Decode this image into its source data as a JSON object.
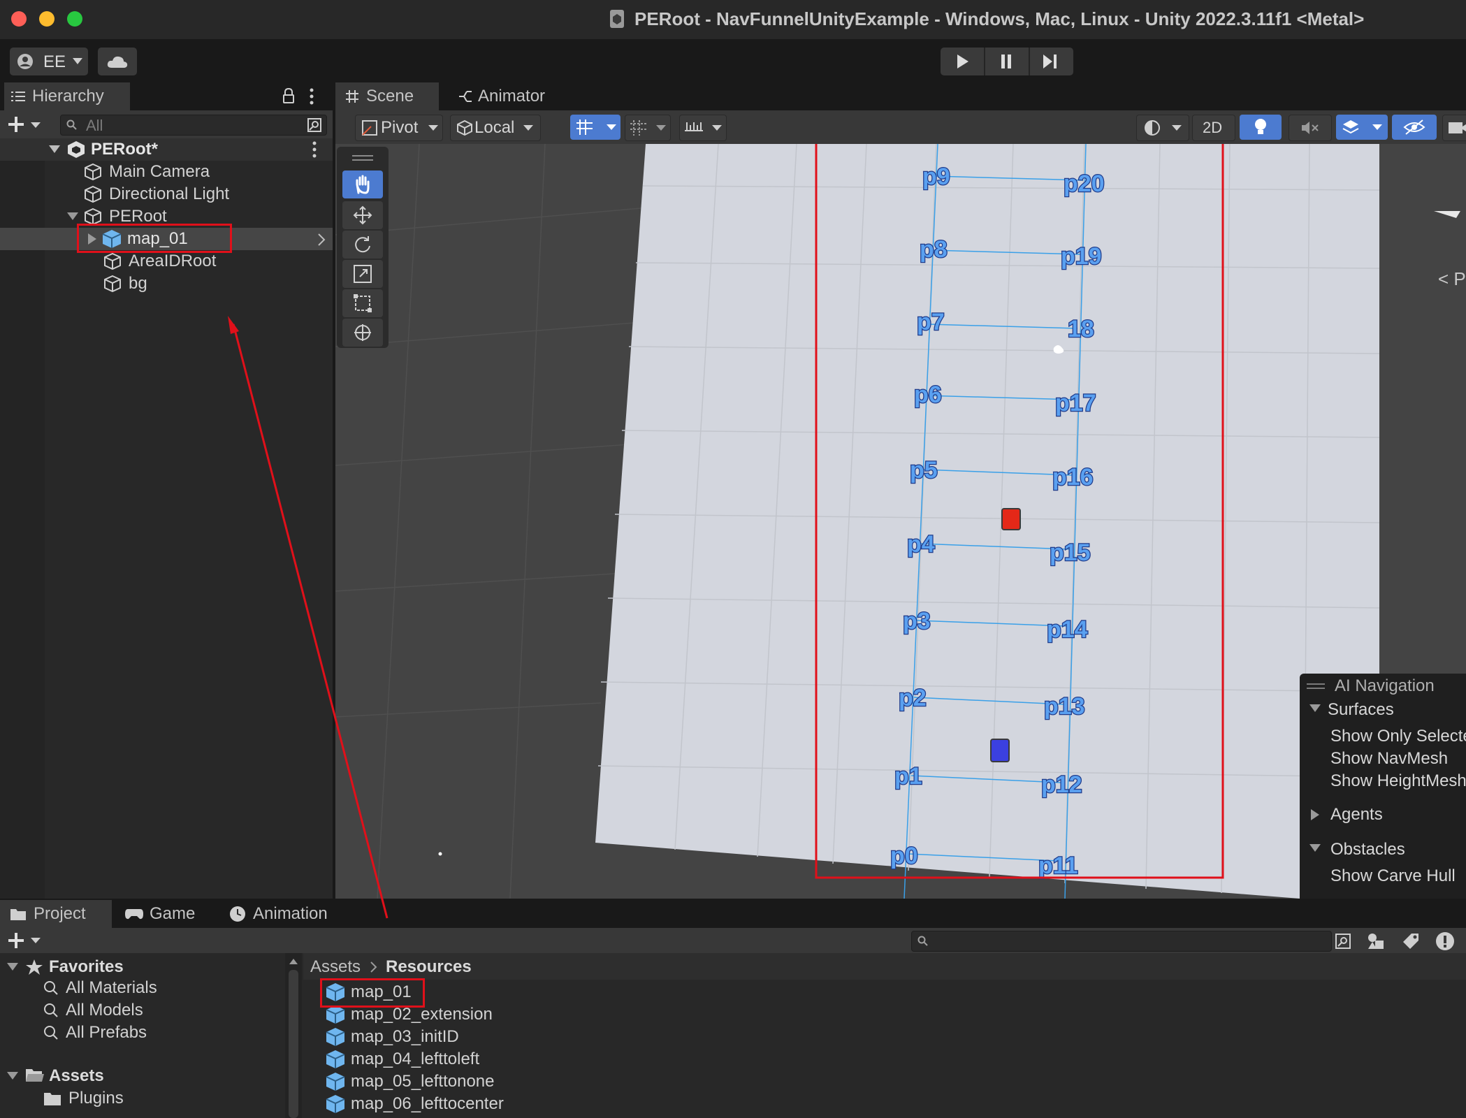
{
  "window": {
    "title": "PERoot - NavFunnelUnityExample - Windows, Mac, Linux - Unity 2022.3.11f1 <Metal>"
  },
  "toolbar": {
    "account_label": "EE",
    "play_icon": "play-icon",
    "pause_icon": "pause-icon",
    "step_icon": "step-icon"
  },
  "hierarchy": {
    "tab_label": "Hierarchy",
    "search_placeholder": "All",
    "scene_root": "PERoot*",
    "items": [
      {
        "label": "Main Camera"
      },
      {
        "label": "Directional Light"
      },
      {
        "label": "PERoot"
      },
      {
        "label": "map_01"
      },
      {
        "label": "AreaIDRoot"
      },
      {
        "label": "bg"
      }
    ]
  },
  "scene": {
    "tabs": [
      {
        "label": "Scene"
      },
      {
        "label": "Animator"
      }
    ],
    "pivot_label": "Pivot",
    "local_label": "Local",
    "mode_2d_label": "2D",
    "points_left": [
      "p9",
      "p8",
      "p7",
      "p6",
      "p5",
      "p4",
      "p3",
      "p2",
      "p1",
      "p0"
    ],
    "points_right": [
      "p20",
      "p19",
      "18",
      "p17",
      "p16",
      "p15",
      "p14",
      "p13",
      "p12",
      "p11"
    ],
    "gizmo_partial_label": "< P"
  },
  "ai_navigation": {
    "title": "AI Navigation",
    "surfaces_label": "Surfaces",
    "surfaces_items": [
      "Show Only Selected",
      "Show NavMesh",
      "Show HeightMesh"
    ],
    "agents_label": "Agents",
    "obstacles_label": "Obstacles",
    "obstacles_items": [
      "Show Carve Hull"
    ]
  },
  "bottom": {
    "tabs": [
      {
        "label": "Project"
      },
      {
        "label": "Game"
      },
      {
        "label": "Animation"
      }
    ],
    "favorites_label": "Favorites",
    "favorites_items": [
      "All Materials",
      "All Models",
      "All Prefabs"
    ],
    "assets_label": "Assets",
    "assets_items": [
      "Plugins"
    ],
    "breadcrumb": [
      "Assets",
      "Resources"
    ],
    "resources_items": [
      "map_01",
      "map_02_extension",
      "map_03_initID",
      "map_04_lefttoleft",
      "map_05_lefttonone",
      "map_06_lefttocenter"
    ]
  },
  "colors": {
    "accent": "#4c7bd0",
    "highlight_red": "#e0101a",
    "panel": "#282828",
    "scene_floor": "#d3d6de"
  }
}
